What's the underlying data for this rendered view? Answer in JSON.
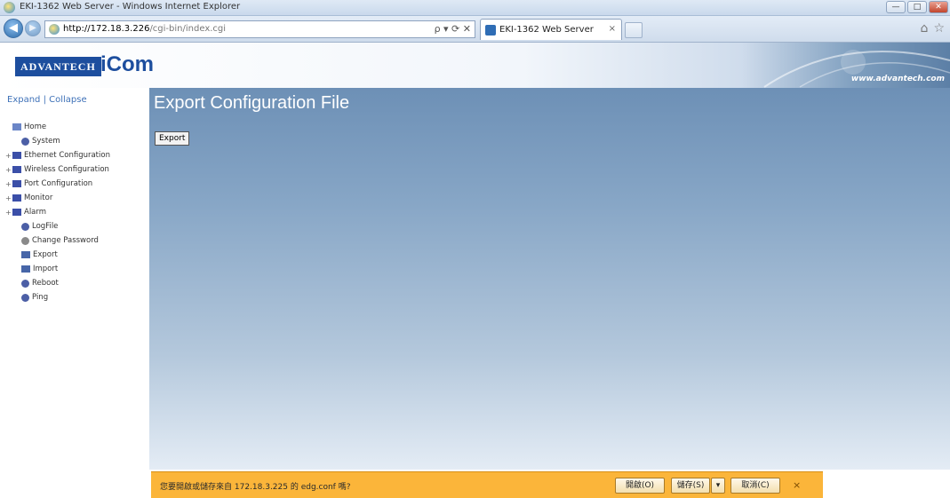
{
  "window": {
    "title": "EKI-1362 Web Server - Windows Internet Explorer",
    "buttons": {
      "minimize": "—",
      "maximize": "□",
      "close": "✕"
    }
  },
  "browser": {
    "url_host": "http://172.18.3.226",
    "url_path": "/cgi-bin/index.cgi",
    "address_controls": "ρ ▾ ⟳ ✕",
    "tab_label": "EKI-1362 Web Server",
    "tab_close": "×",
    "tool_icons": [
      "home-icon",
      "star-icon"
    ]
  },
  "header": {
    "logo_text": "ADVANTECH",
    "brand_text": "iCom",
    "site_url": "www.advantech.com"
  },
  "sidebar": {
    "head": "Expand | Collapse",
    "items": [
      {
        "label": "Home",
        "expander": "",
        "icon": "home-icon",
        "indent": 0
      },
      {
        "label": "System",
        "expander": "",
        "icon": "gear-icon",
        "indent": 1
      },
      {
        "label": "Ethernet Configuration",
        "expander": "+",
        "icon": "folder-icon",
        "indent": 0
      },
      {
        "label": "Wireless Configuration",
        "expander": "+",
        "icon": "folder-icon",
        "indent": 0
      },
      {
        "label": "Port Configuration",
        "expander": "+",
        "icon": "folder-icon",
        "indent": 0
      },
      {
        "label": "Monitor",
        "expander": "+",
        "icon": "folder-icon",
        "indent": 0
      },
      {
        "label": "Alarm",
        "expander": "+",
        "icon": "folder-icon",
        "indent": 0
      },
      {
        "label": "LogFile",
        "expander": "",
        "icon": "gear-icon",
        "indent": 1
      },
      {
        "label": "Change Password",
        "expander": "",
        "icon": "key-icon",
        "indent": 1
      },
      {
        "label": "Export",
        "expander": "",
        "icon": "export-icon",
        "indent": 1
      },
      {
        "label": "Import",
        "expander": "",
        "icon": "import-icon",
        "indent": 1
      },
      {
        "label": "Reboot",
        "expander": "",
        "icon": "gear-icon",
        "indent": 1
      },
      {
        "label": "Ping",
        "expander": "",
        "icon": "gear-icon",
        "indent": 1
      }
    ]
  },
  "content": {
    "title": "Export Configuration File",
    "export_button": "Export"
  },
  "download_bar": {
    "message": "您要開啟或儲存來自 172.18.3.225 的 edg.conf 嗎?",
    "open_label": "開啟(O)",
    "save_label": "儲存(S)",
    "dropdown_label": "▾",
    "cancel_label": "取消(C)",
    "close_label": "×"
  },
  "colors": {
    "brand_blue": "#1d4e9e",
    "content_top": "#6d90b6",
    "download_bar": "#fbb53a"
  }
}
